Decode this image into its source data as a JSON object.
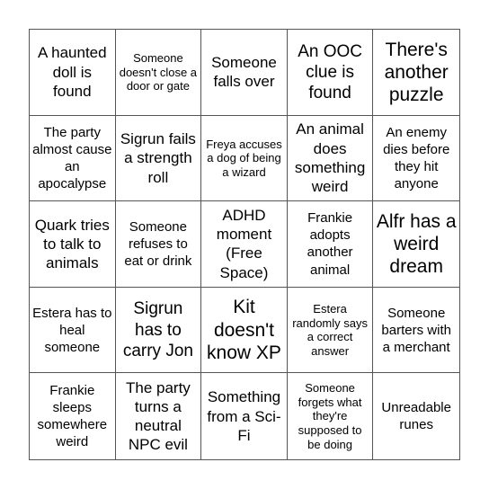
{
  "board": {
    "size": 5,
    "cells": [
      {
        "text": "A haunted doll is found",
        "size": "s-md"
      },
      {
        "text": "Someone doesn't close a door or gate",
        "size": "s-xs"
      },
      {
        "text": "Someone falls over",
        "size": "s-md"
      },
      {
        "text": "An OOC clue is found",
        "size": "s-lg"
      },
      {
        "text": "There's another puzzle",
        "size": "s-xl"
      },
      {
        "text": "The party almost cause an apocalypse",
        "size": "s-sm"
      },
      {
        "text": "Sigrun fails a strength roll",
        "size": "s-md"
      },
      {
        "text": "Freya accuses a dog of being a wizard",
        "size": "s-xs"
      },
      {
        "text": "An animal does something weird",
        "size": "s-md"
      },
      {
        "text": "An enemy dies before they hit anyone",
        "size": "s-sm"
      },
      {
        "text": "Quark tries to talk to animals",
        "size": "s-md"
      },
      {
        "text": "Someone refuses to eat or drink",
        "size": "s-sm"
      },
      {
        "text": "ADHD moment (Free Space)",
        "size": "s-md"
      },
      {
        "text": "Frankie adopts another animal",
        "size": "s-sm"
      },
      {
        "text": "Alfr has a weird dream",
        "size": "s-xl"
      },
      {
        "text": "Estera has to heal someone",
        "size": "s-sm"
      },
      {
        "text": "Sigrun has to carry Jon",
        "size": "s-lg"
      },
      {
        "text": "Kit doesn't know XP",
        "size": "s-xl"
      },
      {
        "text": "Estera randomly says a correct answer",
        "size": "s-xs"
      },
      {
        "text": "Someone barters with a merchant",
        "size": "s-sm"
      },
      {
        "text": "Frankie sleeps somewhere weird",
        "size": "s-sm"
      },
      {
        "text": "The party turns a neutral NPC evil",
        "size": "s-md"
      },
      {
        "text": "Something from a Sci-Fi",
        "size": "s-md"
      },
      {
        "text": "Someone forgets what they're supposed to be doing",
        "size": "s-xs"
      },
      {
        "text": "Unreadable runes",
        "size": "s-sm"
      }
    ]
  }
}
